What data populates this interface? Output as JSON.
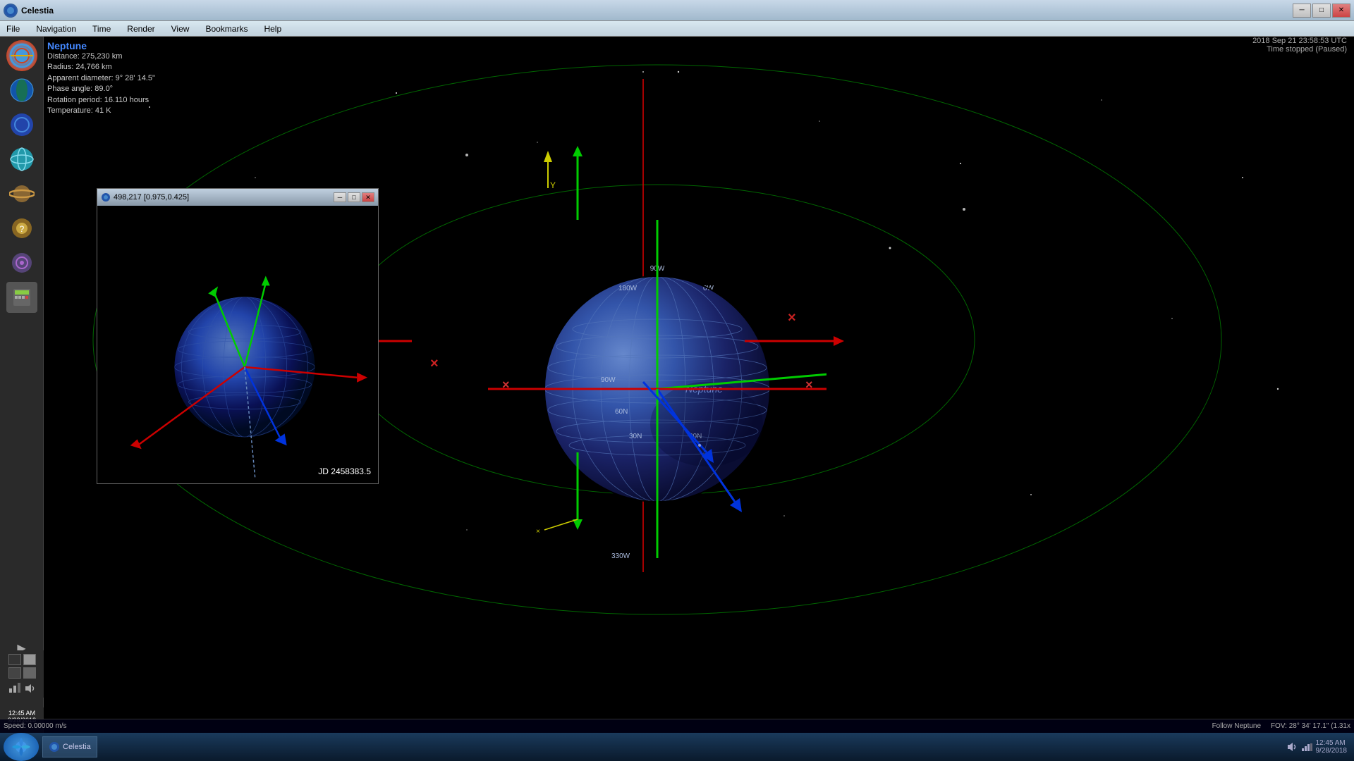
{
  "app": {
    "title": "Celestia",
    "icon": "celestia-icon"
  },
  "titlebar": {
    "title": "Celestia",
    "minimize_label": "─",
    "maximize_label": "□",
    "close_label": "✕"
  },
  "menubar": {
    "items": [
      {
        "label": "File",
        "id": "file"
      },
      {
        "label": "Navigation",
        "id": "navigation"
      },
      {
        "label": "Time",
        "id": "time"
      },
      {
        "label": "Render",
        "id": "render"
      },
      {
        "label": "View",
        "id": "view"
      },
      {
        "label": "Bookmarks",
        "id": "bookmarks"
      },
      {
        "label": "Help",
        "id": "help"
      }
    ]
  },
  "info_panel": {
    "planet_name": "Neptune",
    "distance": "Distance: 275,230 km",
    "radius": "Radius: 24,766 km",
    "apparent_diameter": "Apparent diameter: 9° 28' 14.5\"",
    "phase_angle": "Phase angle: 89.0°",
    "rotation_period": "Rotation period: 16.110 hours",
    "temperature": "Temperature: 41 K"
  },
  "time_display": {
    "datetime": "2018 Sep 21 23:58:53 UTC",
    "status": "Time stopped (Paused)"
  },
  "sub_window": {
    "title": "498,217 [0.975,0.425]",
    "jd_label": "JD 2458383.5",
    "minimize_label": "─",
    "maximize_label": "□",
    "close_label": "✕"
  },
  "status_bar": {
    "speed": "Speed: 0.00000 m/s",
    "follow": "Follow Neptune",
    "fov": "FOV: 28° 34' 17.1\" (1.31x"
  },
  "sidebar": {
    "icons": [
      {
        "name": "browser-icon",
        "color": "#4488cc"
      },
      {
        "name": "earth-icon",
        "color": "#4499aa"
      },
      {
        "name": "user-icon",
        "color": "#4488cc"
      },
      {
        "name": "globe-icon",
        "color": "#44aacc"
      },
      {
        "name": "star-icon",
        "color": "#cc8844"
      },
      {
        "name": "badge-icon",
        "color": "#ccaa44"
      },
      {
        "name": "target-icon",
        "color": "#aa44cc"
      },
      {
        "name": "calculator-icon",
        "color": "#888888"
      }
    ]
  },
  "taskbar_bottom": {
    "time": "12:45 AM",
    "date": "9/28/2018"
  },
  "colors": {
    "neptune_body": "#3355aa",
    "axis_green": "#00dd00",
    "axis_red": "#dd0000",
    "axis_blue": "#0000dd",
    "orbit_color": "#006600",
    "grid_color": "#4466aa",
    "background": "#000000"
  }
}
